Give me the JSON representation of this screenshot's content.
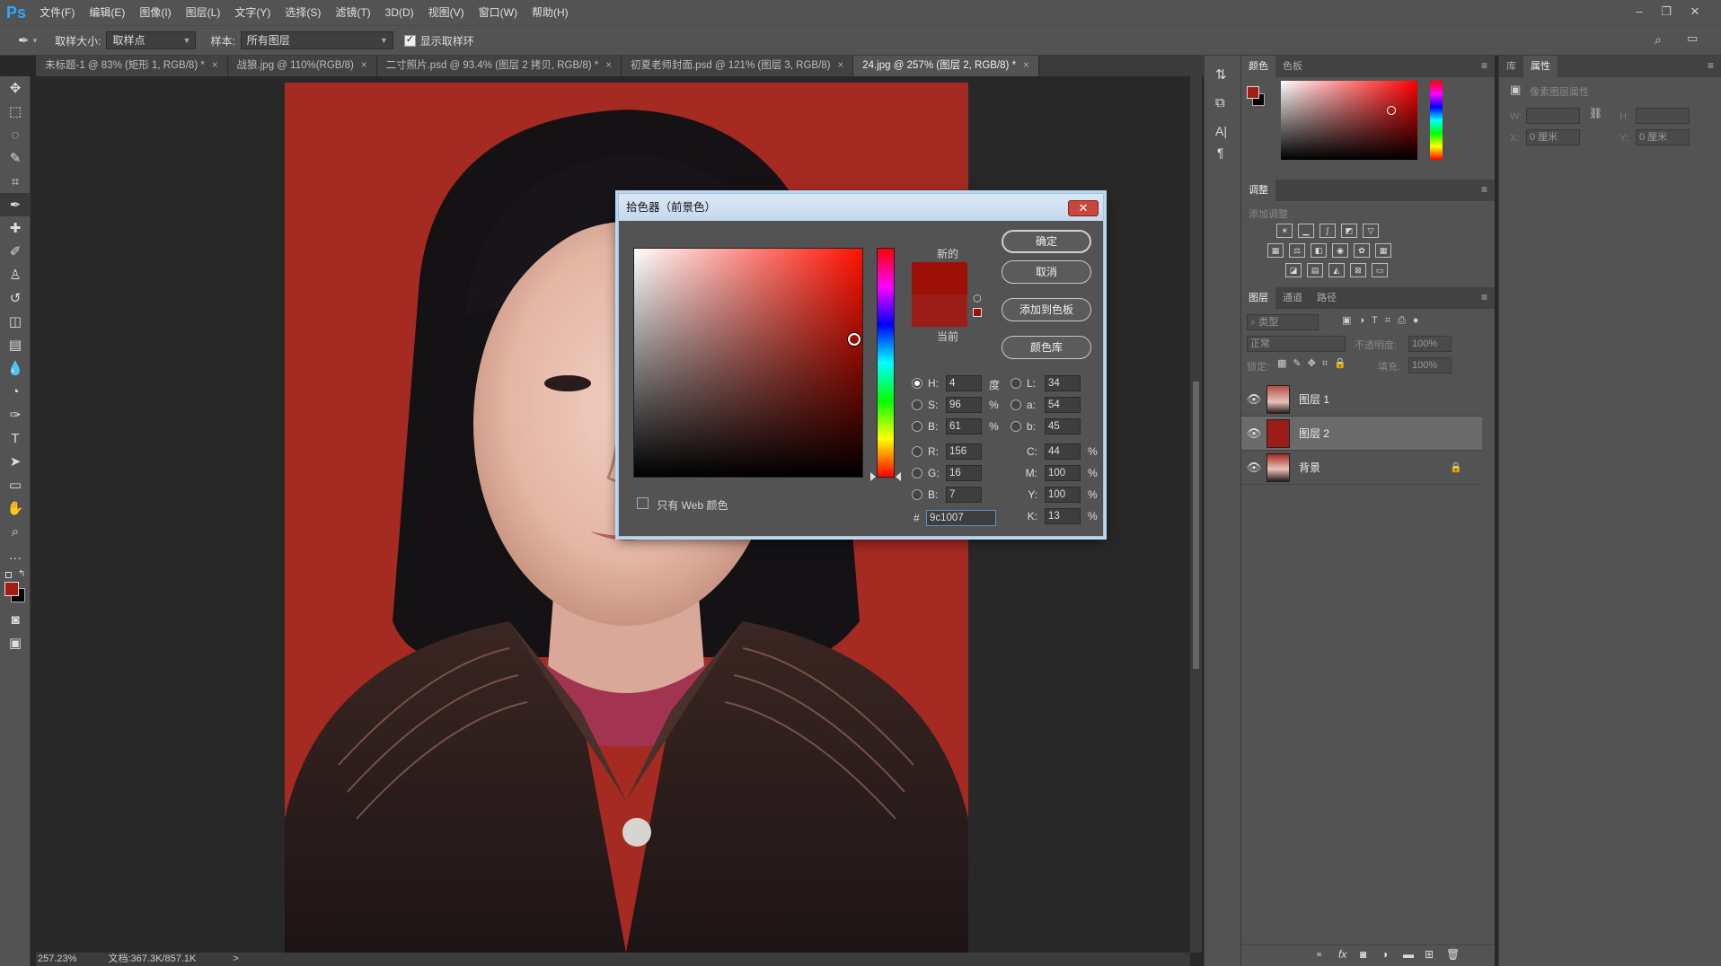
{
  "app": {
    "logo": "Ps"
  },
  "menu": [
    "文件(F)",
    "编辑(E)",
    "图像(I)",
    "图层(L)",
    "文字(Y)",
    "选择(S)",
    "滤镜(T)",
    "3D(D)",
    "视图(V)",
    "窗口(W)",
    "帮助(H)"
  ],
  "options": {
    "sample_size_label": "取样大小:",
    "sample_size_value": "取样点",
    "sample_label": "样本:",
    "sample_value": "所有图层",
    "show_ring_label": "显示取样环",
    "show_ring_checked": true
  },
  "tabs": [
    {
      "label": "未标题-1 @ 83% (矩形 1, RGB/8) *",
      "close": "×"
    },
    {
      "label": "战狼.jpg @ 110%(RGB/8)",
      "close": "×"
    },
    {
      "label": "二寸照片.psd @ 93.4% (图层 2 拷贝, RGB/8) *",
      "close": "×"
    },
    {
      "label": "初夏老师封面.psd @ 121% (图层 3, RGB/8)",
      "close": "×"
    },
    {
      "label": "24.jpg @ 257% (图层 2, RGB/8) *",
      "close": "×"
    }
  ],
  "status": {
    "zoom": "257.23%",
    "doc": "文档:367.3K/857.1K",
    "nav": ">"
  },
  "picker": {
    "title": "拾色器（前景色）",
    "close": "✕",
    "new_label": "新的",
    "current_label": "当前",
    "new_color": "#9c1007",
    "current_color": "#9c1c17",
    "buttons": {
      "ok": "确定",
      "cancel": "取消",
      "add_swatch": "添加到色板",
      "libraries": "颜色库"
    },
    "web_only_label": "只有 Web 颜色",
    "hsb": {
      "h_label": "H:",
      "h": "4",
      "h_unit": "度",
      "s_label": "S:",
      "s": "96",
      "s_unit": "%",
      "b_label": "B:",
      "b": "61",
      "b_unit": "%"
    },
    "lab": {
      "l_label": "L:",
      "l": "34",
      "a_label": "a:",
      "a": "54",
      "b_label": "b:",
      "b": "45"
    },
    "rgb": {
      "r_label": "R:",
      "r": "156",
      "g_label": "G:",
      "g": "16",
      "b_label": "B:",
      "b": "7"
    },
    "cmyk": {
      "c_label": "C:",
      "c": "44",
      "m_label": "M:",
      "m": "100",
      "y_label": "Y:",
      "y": "100",
      "k_label": "K:",
      "k": "13",
      "unit": "%"
    },
    "hex_label": "#",
    "hex": "9c1007"
  },
  "color_panel": {
    "tabs": [
      "颜色",
      "色板"
    ],
    "fg": "#a41c14",
    "bg": "#000000"
  },
  "adjustments": {
    "tab": "调整",
    "add_label": "添加调整"
  },
  "layers_panel": {
    "tabs": [
      "图层",
      "通道",
      "路径"
    ],
    "filter_placeholder": "类型",
    "blend_mode": "正常",
    "opacity_label": "不透明度:",
    "opacity": "100%",
    "lock_label": "锁定:",
    "fill_label": "填充:",
    "fill": "100%",
    "layers": [
      {
        "name": "图层 1",
        "selected": false
      },
      {
        "name": "图层 2",
        "selected": true
      },
      {
        "name": "背景",
        "selected": false,
        "locked": true
      }
    ]
  },
  "properties": {
    "tabs": [
      "库",
      "属性"
    ],
    "title": "像素图层属性",
    "w_label": "W:",
    "h_label": "H:",
    "x_label": "X:",
    "y_label": "Y:",
    "x_value": "0 厘米",
    "y_value": "0 厘米"
  }
}
